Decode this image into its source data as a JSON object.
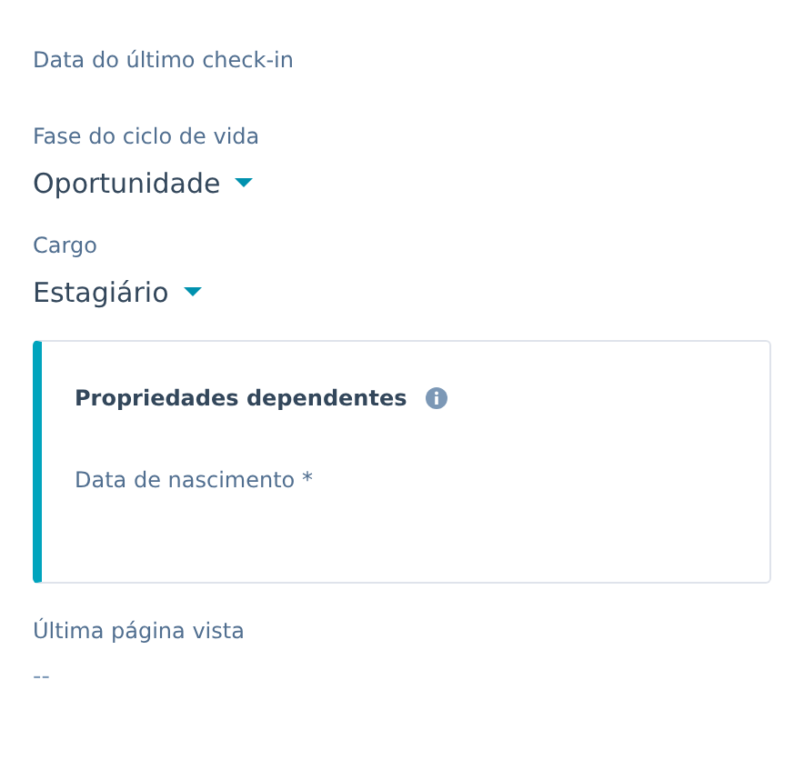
{
  "properties": [
    {
      "kind": "empty",
      "label": "Data do último check-in"
    },
    {
      "kind": "dropdown",
      "label": "Fase do ciclo de vida",
      "value": "Oportunidade"
    },
    {
      "kind": "dropdown",
      "label": "Cargo",
      "value": "Estagiário"
    },
    {
      "kind": "dependent",
      "title": "Propriedades dependentes",
      "fields": [
        {
          "label": "Data de nascimento *"
        }
      ]
    },
    {
      "kind": "text",
      "label": "Última página vista",
      "value": "--"
    }
  ]
}
